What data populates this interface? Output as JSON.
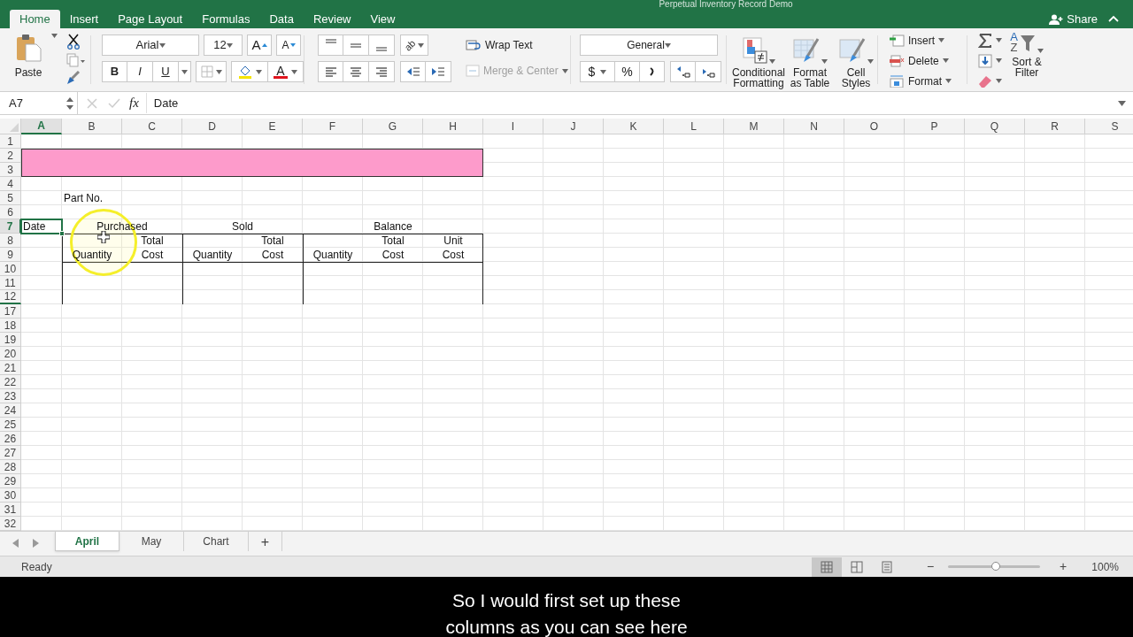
{
  "title": "Perpetual Inventory Record Demo",
  "ribbon_tabs": [
    {
      "label": "Home",
      "selected": true
    },
    {
      "label": "Insert",
      "selected": false
    },
    {
      "label": "Page Layout",
      "selected": false
    },
    {
      "label": "Formulas",
      "selected": false
    },
    {
      "label": "Data",
      "selected": false
    },
    {
      "label": "Review",
      "selected": false
    },
    {
      "label": "View",
      "selected": false
    }
  ],
  "share": "Share",
  "ribbon": {
    "paste": "Paste",
    "font": "Arial",
    "font_size": "12",
    "grow_font": "A",
    "shrink_font": "A",
    "bold": "B",
    "italic": "I",
    "underline": "U",
    "font_color": "A",
    "orientation": "ab",
    "wrap_text": "Wrap Text",
    "merge_center": {
      "label": "Merge & Center",
      "disabled": true
    },
    "number_format": "General",
    "currency": "$",
    "percent": "%",
    "conditional_formatting": "Conditional Formatting",
    "format_as_table": "Format as Table",
    "cell_styles": "Cell Styles",
    "insert": "Insert",
    "delete": "Delete",
    "format": "Format",
    "sort_letters": [
      "A",
      "Z"
    ],
    "sort_filter": "Sort & Filter"
  },
  "formula_bar": {
    "name_box": "A7",
    "fx": "fx",
    "formula": "Date"
  },
  "sheet": {
    "columns": [
      "A",
      "B",
      "C",
      "D",
      "E",
      "F",
      "G",
      "H",
      "I",
      "J",
      "K",
      "L",
      "M",
      "N",
      "O",
      "P",
      "Q",
      "R",
      "S"
    ],
    "rows": [
      "1",
      "2",
      "3",
      "4",
      "5",
      "6",
      "7",
      "8",
      "9",
      "10",
      "11",
      "12",
      "17",
      "18",
      "19",
      "20",
      "21",
      "22",
      "23",
      "24",
      "25",
      "26",
      "27",
      "28",
      "29",
      "30",
      "31",
      "32"
    ],
    "cells": [
      {
        "text": "Part No.",
        "kind": "text",
        "selected": false
      },
      {
        "text": "Date",
        "kind": "text",
        "selected": true
      },
      {
        "text": "Purchased",
        "kind": "heading",
        "selected": false
      },
      {
        "text": "Sold",
        "kind": "heading",
        "selected": false
      },
      {
        "text": "Balance",
        "kind": "heading",
        "selected": false
      },
      {
        "text": "Total",
        "kind": "heading",
        "selected": false
      },
      {
        "text": "Total",
        "kind": "heading",
        "selected": false
      },
      {
        "text": "Total",
        "kind": "heading",
        "selected": false
      },
      {
        "text": "Unit",
        "kind": "heading",
        "selected": false
      },
      {
        "text": "Quantity",
        "kind": "heading",
        "selected": false
      },
      {
        "text": "Cost",
        "kind": "heading",
        "selected": false
      },
      {
        "text": "Quantity",
        "kind": "heading",
        "selected": false
      },
      {
        "text": "Cost",
        "kind": "heading",
        "selected": false
      },
      {
        "text": "Quantity",
        "kind": "heading",
        "selected": false
      },
      {
        "text": "Cost",
        "kind": "heading",
        "selected": false
      },
      {
        "text": "Cost",
        "kind": "heading",
        "selected": false
      }
    ]
  },
  "sheet_tabs": [
    {
      "label": "April",
      "selected": true
    },
    {
      "label": "May",
      "selected": false
    },
    {
      "label": "Chart",
      "selected": false
    }
  ],
  "add_sheet": "+",
  "status_bar": {
    "status": "Ready",
    "view_modes": [
      {
        "kind": "normal",
        "selected": true
      },
      {
        "kind": "page_layout",
        "selected": false
      },
      {
        "kind": "page_break",
        "selected": false
      }
    ],
    "zoom_out": "−",
    "level": 0.52,
    "zoom_in": "+",
    "zoom": "100%"
  },
  "subtitles": [
    "So I would first set up these",
    "columns as you can see here"
  ]
}
